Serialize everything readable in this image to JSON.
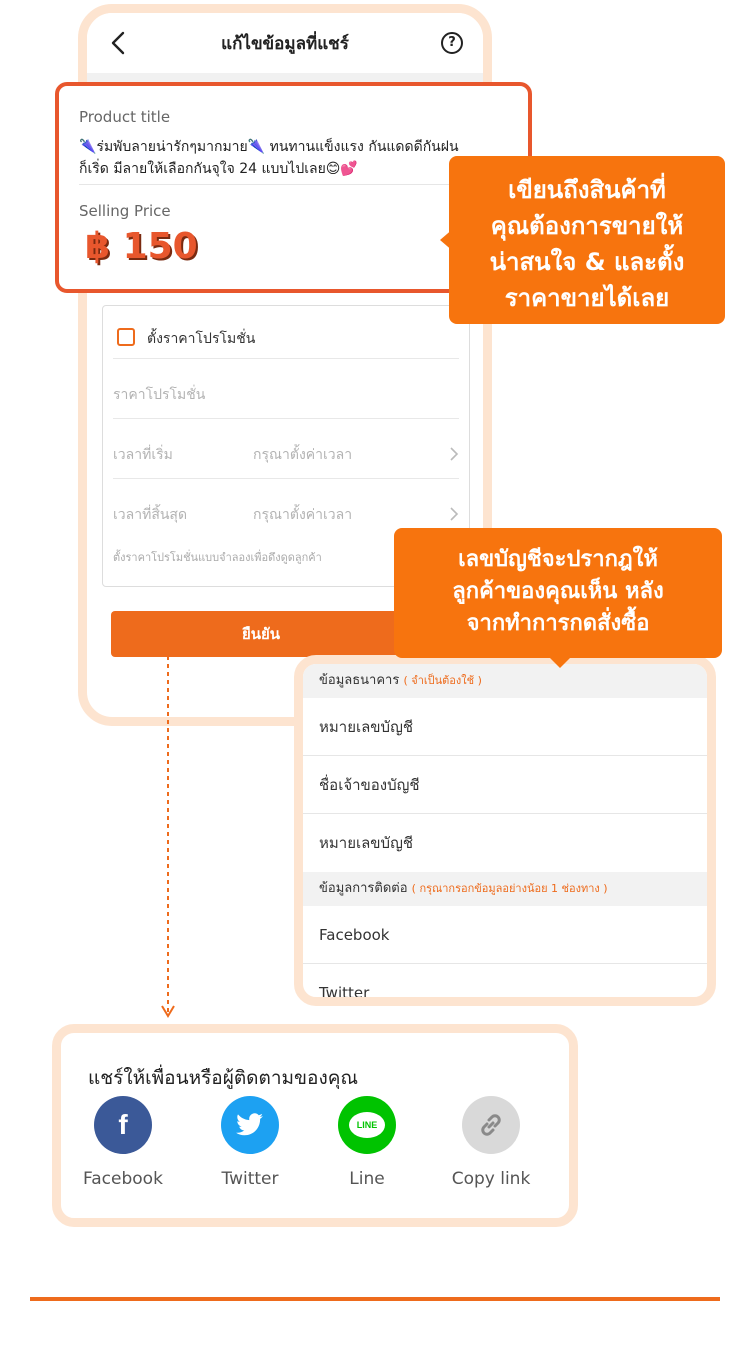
{
  "editor": {
    "title": "แก้ไขข้อมูลที่แชร์",
    "help_symbol": "?",
    "product_title_label": "Product title",
    "product_title_line1": "🌂ร่มพับลายน่ารักๆมากมาย🌂 ทนทานแข็งแรง กันแดดดีกันฝน",
    "product_title_line2": "ก็เริ่ด มีลายให้เลือกกันจุใจ 24 แบบไปเลย😊💕",
    "selling_price_label": "Selling Price",
    "selling_price": "฿ 150",
    "promo_checkbox_label": "ตั้งราคาโปรโมชั่น",
    "promo_price_placeholder": "ราคาโปรโมชั่น",
    "start_time_label": "เวลาที่เริ่ม",
    "end_time_label": "เวลาที่สิ้นสุด",
    "time_placeholder": "กรุณาตั้งค่าเวลา",
    "promo_note": "ตั้งราคาโปรโมชั่นแบบจำลองเพื่อดึงดูดลูกค้า",
    "confirm_button": "ยืนยัน"
  },
  "callouts": {
    "product": [
      "เขียนถึงสินค้าที่",
      "คุณต้องการขายให้",
      "น่าสนใจ & และตั้ง",
      "ราคาขายได้เลย"
    ],
    "bank": [
      "เลขบัญชีจะปรากฎให้",
      "ลูกค้าของคุณเห็น หลัง",
      "จากทำการกดสั่งซื้อ"
    ]
  },
  "bank": {
    "section_label": "ข้อมูลธนาคาร",
    "section_required": "( จำเป็นต้องใช้ )",
    "rows": [
      "หมายเลขบัญชี",
      "ชื่อเจ้าของบัญชี",
      "หมายเลขบัญชี"
    ],
    "contact_label": "ข้อมูลการติดต่อ",
    "contact_required": "( กรุณากรอกข้อมูลอย่างน้อย 1 ช่องทาง )",
    "contact_rows": [
      "Facebook",
      "Twitter"
    ]
  },
  "share": {
    "title": "แชร์ให้เพื่อนหรือผู้ติดตามของคุณ",
    "items": [
      {
        "label": "Facebook",
        "icon": "facebook-icon",
        "color": "#3b5998"
      },
      {
        "label": "Twitter",
        "icon": "twitter-icon",
        "color": "#1da1f2"
      },
      {
        "label": "Line",
        "icon": "line-icon",
        "color": "#00c300"
      },
      {
        "label": "Copy link",
        "icon": "link-icon",
        "color": "#d9d9d9"
      }
    ],
    "line_badge": "LINE"
  },
  "colors": {
    "accent": "#ee6b1c",
    "callout": "#f7740e",
    "frame": "#fde4d0",
    "product_border": "#e8572d"
  }
}
